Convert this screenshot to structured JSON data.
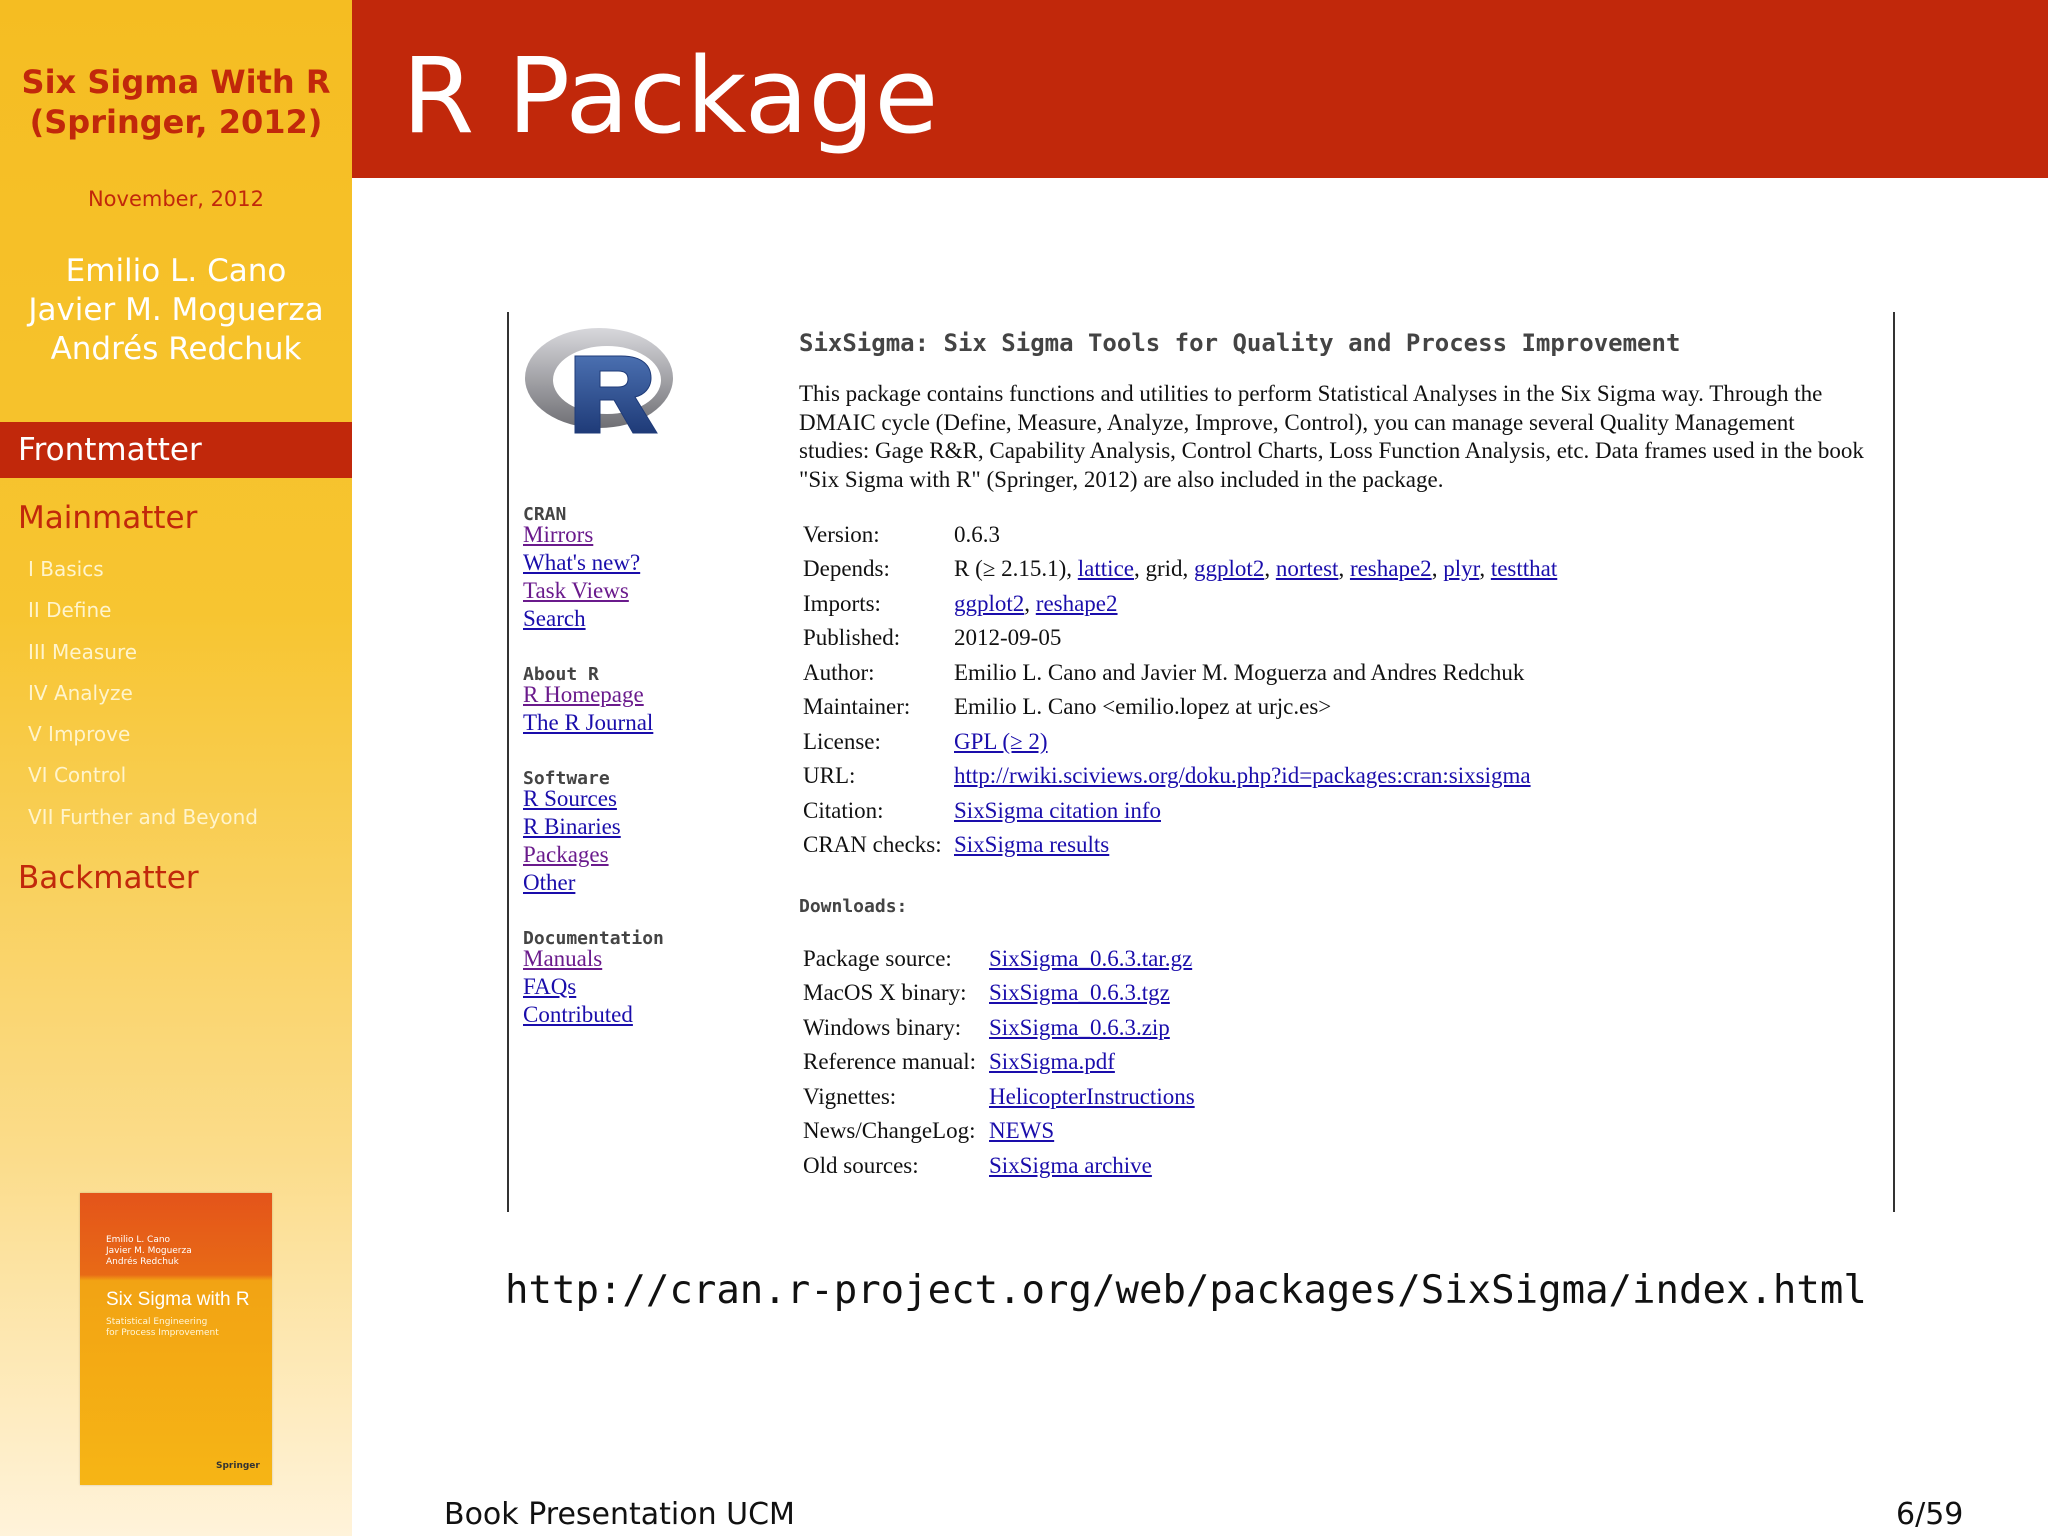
{
  "sidebar": {
    "title_line1": "Six Sigma With R",
    "title_line2": "(Springer, 2012)",
    "date": "November, 2012",
    "authors": [
      "Emilio L. Cano",
      "Javier M. Moguerza",
      "Andrés Redchuk"
    ],
    "sections": {
      "front": "Frontmatter",
      "main": "Mainmatter",
      "back": "Backmatter"
    },
    "subsections": [
      "I Basics",
      "II Define",
      "III Measure",
      "IV Analyze",
      "V Improve",
      "VI Control",
      "VII Further and Beyond"
    ],
    "cover": {
      "authors": [
        "Emilio L. Cano",
        "Javier M. Moguerza",
        "Andrés Redchuk"
      ],
      "title": "Six Sigma with R",
      "subtitle": [
        "Statistical Engineering",
        "for Process Improvement"
      ],
      "publisher": "Springer"
    }
  },
  "frame": {
    "title": "R Package"
  },
  "cran": {
    "nav": {
      "cran_heading": "CRAN",
      "cran_links": [
        "Mirrors",
        "What's new?",
        "Task Views",
        "Search"
      ],
      "about_heading": "About R",
      "about_links": [
        "R Homepage",
        "The R Journal"
      ],
      "software_heading": "Software",
      "software_links": [
        "R Sources",
        "R Binaries",
        "Packages",
        "Other"
      ],
      "doc_heading": "Documentation",
      "doc_links": [
        "Manuals",
        "FAQs",
        "Contributed"
      ]
    },
    "title": "SixSigma: Six Sigma Tools for Quality and Process Improvement",
    "description": "This package contains functions and utilities to perform Statistical Analyses in the Six Sigma way. Through the DMAIC cycle (Define, Measure, Analyze, Improve, Control), you can manage several Quality Management studies: Gage R&R, Capability Analysis, Control Charts, Loss Function Analysis, etc. Data frames used in the book \"Six Sigma with R\" (Springer, 2012) are also included in the package.",
    "info": {
      "version_label": "Version:",
      "version": "0.6.3",
      "depends_label": "Depends:",
      "depends_prefix": "R (≥ 2.15.1),",
      "depends_links": [
        "lattice",
        "grid",
        "ggplot2",
        "nortest",
        "reshape2",
        "plyr",
        "testthat"
      ],
      "imports_label": "Imports:",
      "imports_links": [
        "ggplot2",
        "reshape2"
      ],
      "published_label": "Published:",
      "published": "2012-09-05",
      "author_label": "Author:",
      "author": "Emilio L. Cano and Javier M. Moguerza and Andres Redchuk",
      "maintainer_label": "Maintainer:",
      "maintainer": "Emilio L. Cano <emilio.lopez at urjc.es>",
      "license_label": "License:",
      "license": "GPL (≥ 2)",
      "url_label": "URL:",
      "url": "http://rwiki.sciviews.org/doku.php?id=packages:cran:sixsigma",
      "citation_label": "Citation:",
      "citation": "SixSigma citation info",
      "checks_label": "CRAN checks:",
      "checks": "SixSigma results"
    },
    "downloads": {
      "heading": "Downloads:",
      "rows": [
        {
          "label": "Package source:",
          "value": "SixSigma_0.6.3.tar.gz"
        },
        {
          "label": "MacOS X binary:",
          "value": "SixSigma_0.6.3.tgz"
        },
        {
          "label": "Windows binary:",
          "value": "SixSigma_0.6.3.zip"
        },
        {
          "label": "Reference manual:",
          "value": "SixSigma.pdf"
        },
        {
          "label": "Vignettes:",
          "value": "HelicopterInstructions"
        },
        {
          "label": "News/ChangeLog:",
          "value": "NEWS"
        },
        {
          "label": "Old sources:",
          "value": "SixSigma archive"
        }
      ]
    }
  },
  "url": "http://cran.r-project.org/web/packages/SixSigma/index.html",
  "footer": {
    "left": "Book Presentation UCM",
    "right": "6/59"
  },
  "colors": {
    "header_red": "#c1280b",
    "sidebar_yellow": "#f5bd22",
    "link_blue": "#1a0dab",
    "visited_purple": "#6a1a8c"
  }
}
